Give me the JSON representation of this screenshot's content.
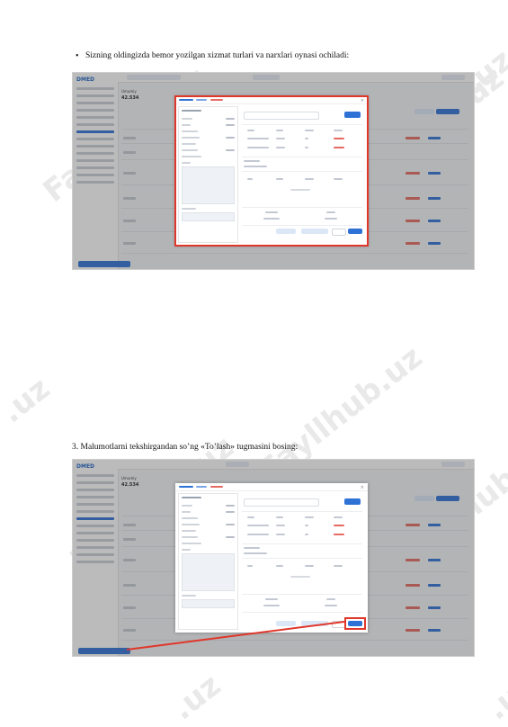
{
  "text": {
    "bullet_symbol": "•",
    "instruction_top": "Sizning oldingizda bemor yozilgan xizmat turlari va narxlari oynasi ochiladi:",
    "instruction_step3": "3. Malumotlarni tekshirgandan so’ng «To’lash» tugmasini bosing:"
  },
  "watermark": {
    "text": "Fayllhub.uz",
    "fragment": ".uz"
  },
  "screenshot": {
    "logo": "DMED",
    "field_label": "Umumiy",
    "field_value": "42.534"
  },
  "colors": {
    "accent": "#2f72d6",
    "highlight": "#e0372b",
    "watermark": "#e9e9e9"
  }
}
